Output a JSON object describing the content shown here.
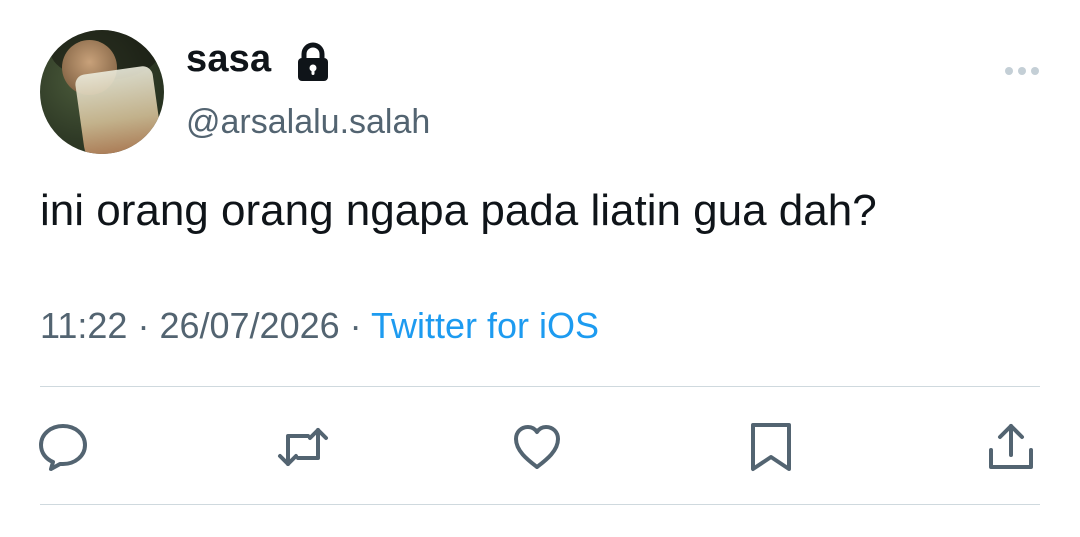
{
  "user": {
    "display_name": "sasa",
    "handle": "@arsalalu.salah",
    "protected": true
  },
  "tweet": {
    "text": "ini orang orang ngapa pada liatin gua dah?",
    "time": "11:22",
    "separator": "·",
    "date": "26/07/2026",
    "source": "Twitter for iOS"
  },
  "actions": [
    {
      "name": "reply",
      "icon": "comment-icon"
    },
    {
      "name": "retweet",
      "icon": "retweet-icon"
    },
    {
      "name": "like",
      "icon": "heart-icon"
    },
    {
      "name": "bookmark",
      "icon": "bookmark-icon"
    },
    {
      "name": "share",
      "icon": "share-icon"
    }
  ],
  "colors": {
    "text": "#0f1419",
    "secondary": "#536471",
    "link": "#1d9bf0",
    "divider": "#cfd9de"
  }
}
